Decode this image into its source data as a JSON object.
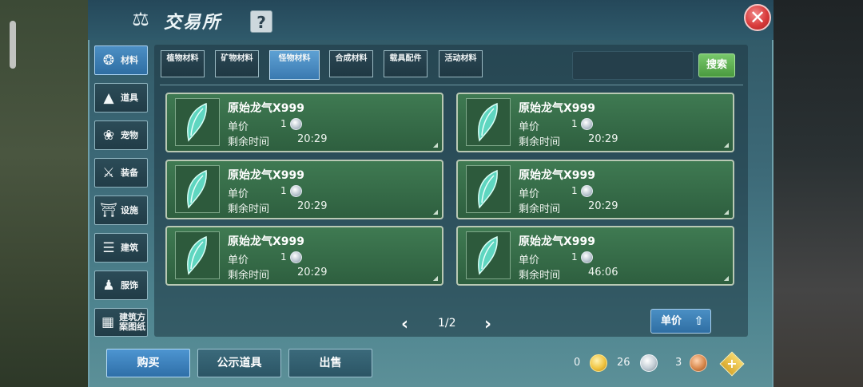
{
  "window": {
    "title": "交易所",
    "help_label": "?",
    "close_label": "✕"
  },
  "sidebar": {
    "items": [
      {
        "label": "材料",
        "icon": "materials-icon",
        "glyph": "❂",
        "active": true
      },
      {
        "label": "道具",
        "icon": "potion-icon",
        "glyph": "▲"
      },
      {
        "label": "宠物",
        "icon": "paw-icon",
        "glyph": "❀"
      },
      {
        "label": "装备",
        "icon": "sword-shield-icon",
        "glyph": "⚔"
      },
      {
        "label": "设施",
        "icon": "facility-icon",
        "glyph": "⛩"
      },
      {
        "label": "建筑",
        "icon": "wall-icon",
        "glyph": "☰"
      },
      {
        "label": "服饰",
        "icon": "clothing-icon",
        "glyph": "♟"
      },
      {
        "label": "建筑方案图纸",
        "icon": "blueprint-icon",
        "glyph": "▦"
      }
    ]
  },
  "tabs": [
    {
      "label": "植物材料"
    },
    {
      "label": "矿物材料"
    },
    {
      "label": "怪物材料",
      "active": true
    },
    {
      "label": "合成材料"
    },
    {
      "label": "载具配件"
    },
    {
      "label": "活动材料"
    }
  ],
  "search": {
    "value": "",
    "button_label": "搜索"
  },
  "listings": [
    {
      "name": "原始龙气X999",
      "price_label": "单价",
      "price": "1",
      "time_label": "剩余时间",
      "time": "20:29"
    },
    {
      "name": "原始龙气X999",
      "price_label": "单价",
      "price": "1",
      "time_label": "剩余时间",
      "time": "20:29"
    },
    {
      "name": "原始龙气X999",
      "price_label": "单价",
      "price": "1",
      "time_label": "剩余时间",
      "time": "20:29"
    },
    {
      "name": "原始龙气X999",
      "price_label": "单价",
      "price": "1",
      "time_label": "剩余时间",
      "time": "20:29"
    },
    {
      "name": "原始龙气X999",
      "price_label": "单价",
      "price": "1",
      "time_label": "剩余时间",
      "time": "20:29"
    },
    {
      "name": "原始龙气X999",
      "price_label": "单价",
      "price": "1",
      "time_label": "剩余时间",
      "time": "46:06"
    }
  ],
  "pagination": {
    "prev": "‹",
    "next": "›",
    "indicator": "1/2"
  },
  "sort": {
    "label": "单价"
  },
  "actions": {
    "buy": "购买",
    "public_items": "公示道具",
    "sell": "出售"
  },
  "currency": {
    "gold": "0",
    "silver": "26",
    "copper": "3",
    "add": "+"
  },
  "colors": {
    "accent": "#3a79b0",
    "card": "#3f7a52",
    "search": "#4a9a3f",
    "close": "#d93b3b"
  }
}
